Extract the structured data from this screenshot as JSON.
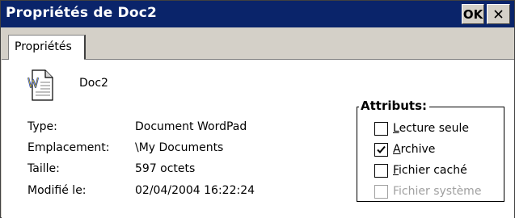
{
  "window": {
    "title": "Propriétés de Doc2",
    "ok_label": "OK",
    "titlebar_color": "#0a246a"
  },
  "tabs": [
    {
      "label": "Propriétés",
      "active": true
    }
  ],
  "file": {
    "name": "Doc2",
    "icon": "wordpad-document-icon"
  },
  "details": [
    {
      "label": "Type:",
      "value": "Document WordPad"
    },
    {
      "label": "Emplacement:",
      "value": "\\My Documents"
    },
    {
      "label": "Taille:",
      "value": "597 octets"
    },
    {
      "label": "Modifié le:",
      "value": "02/04/2004 16:22:24"
    }
  ],
  "attributes": {
    "title": "Attributs:",
    "items": [
      {
        "access_key": "L",
        "rest": "ecture seule",
        "checked": false,
        "enabled": true
      },
      {
        "access_key": "A",
        "rest": "rchive",
        "checked": true,
        "enabled": true
      },
      {
        "access_key": "F",
        "rest": "ichier caché",
        "checked": false,
        "enabled": true
      },
      {
        "access_key": "",
        "rest": "Fichier système",
        "checked": false,
        "enabled": false
      }
    ]
  }
}
